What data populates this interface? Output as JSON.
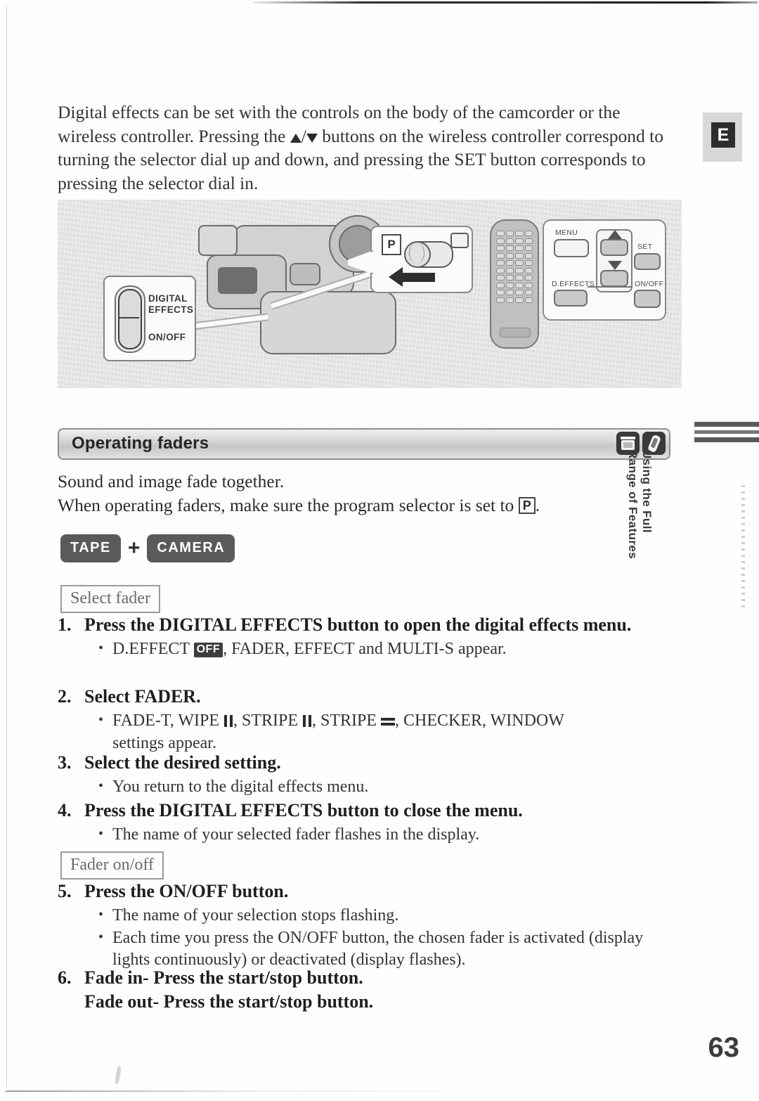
{
  "page": {
    "number": "63",
    "language_badge": "E"
  },
  "intro": {
    "line1": "Digital effects can be set with the controls on the body of the camcorder or the",
    "line2_a": "wireless controller. Pressing the",
    "line2_b": "buttons on the wireless controller",
    "line3": "correspond to turning the selector dial up and down, and pressing the SET button",
    "line4": "corresponds to pressing the selector dial in."
  },
  "illustration": {
    "camcorder_callout": {
      "label_digital": "DIGITAL",
      "label_effects": "EFFECTS",
      "label_onoff": "ON/OFF"
    },
    "program_selector_callout": {
      "label_p": "P"
    },
    "remote_callout": {
      "label_menu": "MENU",
      "label_set": "SET",
      "label_deffects": "D.EFFECTS",
      "label_onoff": "ON/OFF"
    }
  },
  "section": {
    "title": "Operating faders",
    "icons": [
      "cassette-icon",
      "remote-icon"
    ],
    "lead_line1": "Sound and image fade together.",
    "lead_line2_a": "When operating faders, make sure the program selector is set to",
    "lead_line2_p": "P",
    "lead_line2_b": "."
  },
  "mode_badges": {
    "tape": "TAPE",
    "plus": "+",
    "camera": "CAMERA"
  },
  "captions": {
    "select_fader": "Select fader",
    "fader_onoff": "Fader on/off"
  },
  "steps": [
    {
      "num": "1.",
      "head": "Press the DIGITAL EFFECTS button to open the digital effects menu.",
      "bullet_pre": "D.EFFECT",
      "bullet_badge": "OFF",
      "bullet_post": ", FADER, EFFECT and MULTI-S appear."
    },
    {
      "num": "2.",
      "head": "Select FADER.",
      "bullet_a": "FADE-T, WIPE",
      "bullet_b": ", STRIPE",
      "bullet_c": ", STRIPE",
      "bullet_d": ", CHECKER, WINDOW",
      "bullet_e": "settings appear."
    },
    {
      "num": "3.",
      "head": "Select the desired setting.",
      "bullet": "You return to the digital effects menu."
    },
    {
      "num": "4.",
      "head": "Press the DIGITAL EFFECTS button to close the menu.",
      "bullet": "The name of your selected fader flashes in the display."
    },
    {
      "num": "5.",
      "head": "Press the ON/OFF button.",
      "bullet1": "The name of your selection stops flashing.",
      "bullet2_line1": "Each time you press the ON/OFF button, the chosen fader is activated",
      "bullet2_line2": "(display lights continuously) or deactivated (display flashes)."
    },
    {
      "num": "6.",
      "head": "Fade in- Press the start/stop button.",
      "extra": "Fade out- Press the start/stop button."
    }
  ],
  "sidebar": {
    "line1": "Using the Full",
    "line2": "Range of Features"
  }
}
